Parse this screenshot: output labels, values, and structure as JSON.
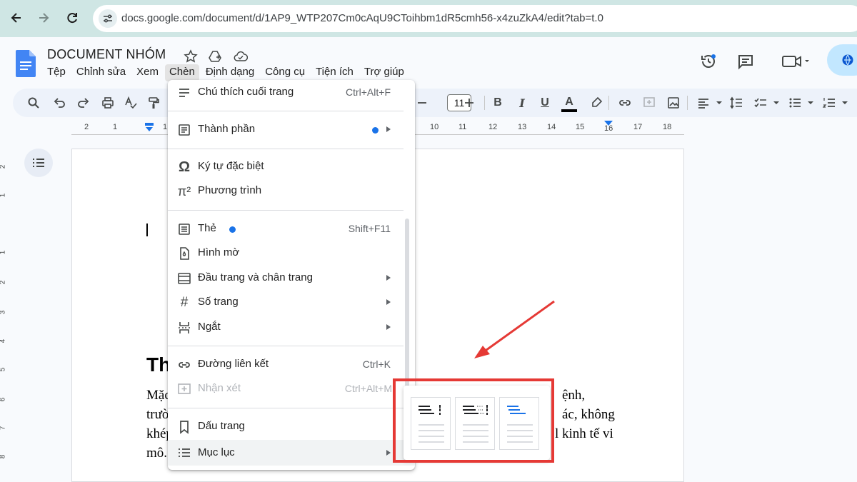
{
  "browser": {
    "url": "docs.google.com/document/d/1AP9_WTP207Cm0cAqU9CToihbm1dR5cmh56-x4zuZkA4/edit?tab=t.0"
  },
  "document": {
    "title": "DOCUMENT NHÓM",
    "menus": [
      "Tệp",
      "Chỉnh sửa",
      "Xem",
      "Chèn",
      "Định dạng",
      "Công cụ",
      "Tiện ích",
      "Trợ giúp"
    ],
    "active_menu": "Chèn"
  },
  "toolbar": {
    "font_size": "11",
    "bold_label": "B",
    "italic_label": "I",
    "underline_label": "U",
    "text_color_label": "A"
  },
  "ruler": {
    "numbers": [
      "2",
      "1",
      "1",
      "10",
      "11",
      "12",
      "13",
      "14",
      "15",
      "16",
      "17",
      "18"
    ]
  },
  "vertical_ruler": {
    "numbers": [
      "2",
      "1",
      "1",
      "2",
      "3",
      "4",
      "5",
      "6",
      "7",
      "8"
    ]
  },
  "page": {
    "heading_partial": "Th",
    "lines": [
      {
        "left": "Mặc",
        "right": "ệnh,"
      },
      {
        "left": "trườ",
        "right": "ác, không"
      },
      {
        "left": "khép",
        "right": "l kinh tế vi"
      },
      {
        "left": "mô.",
        "right": ""
      }
    ]
  },
  "insert_menu": {
    "items": [
      {
        "label": "Chú thích cuối trang",
        "shortcut": "Ctrl+Alt+F",
        "icon": "footnote-icon"
      },
      {
        "label": "Thành phần",
        "icon": "building-blocks-icon",
        "submenu": true,
        "badge": true
      },
      {
        "label": "Ký tự đặc biệt",
        "icon": "omega-icon"
      },
      {
        "label": "Phương trình",
        "icon": "pi-icon"
      },
      {
        "label": "Thẻ",
        "shortcut": "Shift+F11",
        "icon": "tab-icon",
        "badge": true
      },
      {
        "label": "Hình mờ",
        "icon": "watermark-icon"
      },
      {
        "label": "Đầu trang và chân trang",
        "icon": "header-footer-icon",
        "submenu": true
      },
      {
        "label": "Số trang",
        "icon": "hash-icon",
        "submenu": true
      },
      {
        "label": "Ngắt",
        "icon": "break-icon",
        "submenu": true
      },
      {
        "label": "Đường liên kết",
        "shortcut": "Ctrl+K",
        "icon": "link-icon"
      },
      {
        "label": "Nhận xét",
        "shortcut": "Ctrl+Alt+M",
        "icon": "comment-add-icon",
        "disabled": true
      },
      {
        "label": "Dấu trang",
        "icon": "bookmark-icon"
      },
      {
        "label": "Mục lục",
        "icon": "toc-icon",
        "submenu": true,
        "hovered": true
      }
    ]
  },
  "toc_submenu": {
    "options": [
      "toc-numbered-option",
      "toc-dotted-option",
      "toc-links-option"
    ]
  },
  "colors": {
    "accent": "#1a73e8",
    "annotation_red": "#e53935",
    "browser_bar": "#cfe6e4"
  }
}
